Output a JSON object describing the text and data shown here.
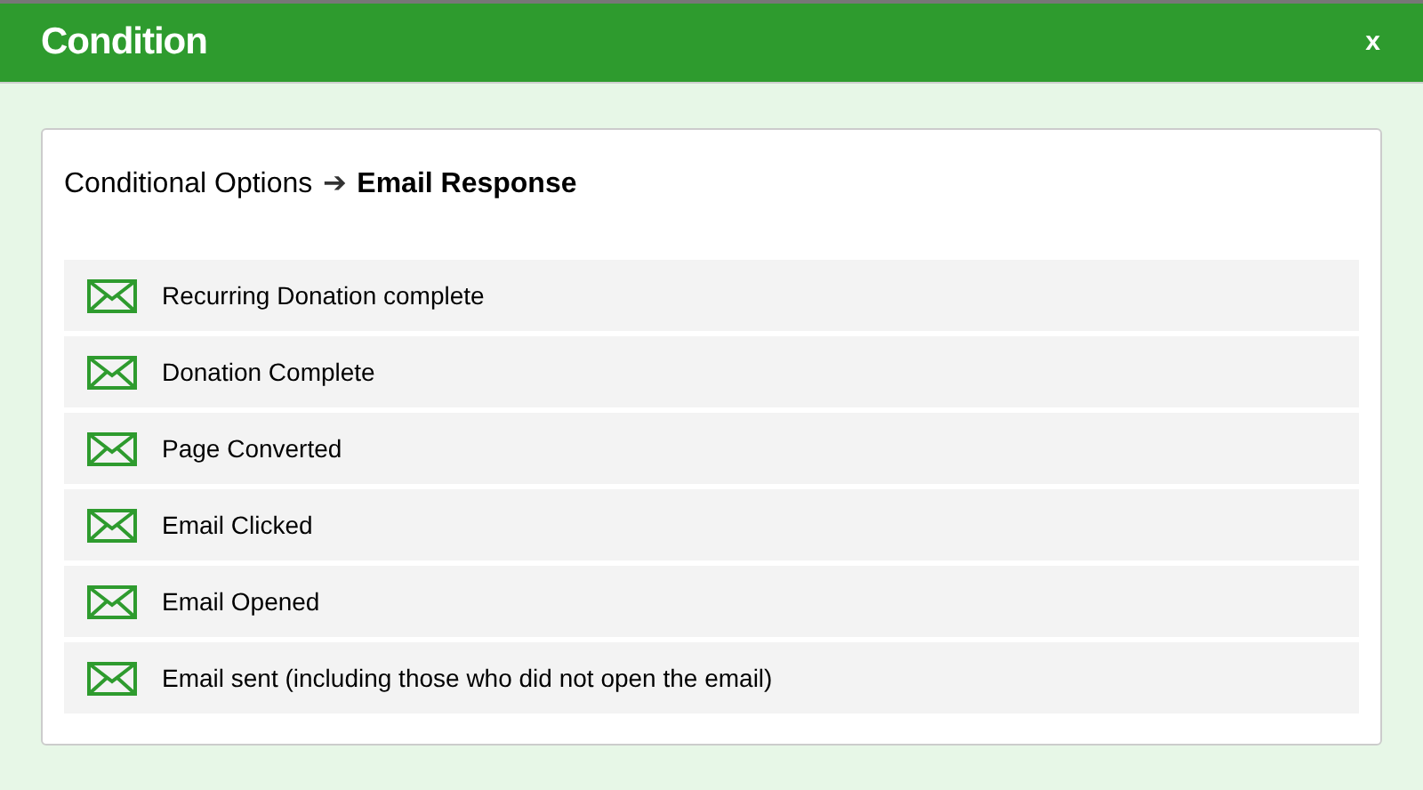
{
  "dialog": {
    "title": "Condition",
    "close": "x"
  },
  "breadcrumb": {
    "parent": "Conditional Options",
    "separator": "➔",
    "current": "Email Response"
  },
  "options": [
    {
      "label": "Recurring Donation complete"
    },
    {
      "label": "Donation Complete"
    },
    {
      "label": "Page Converted"
    },
    {
      "label": "Email Clicked"
    },
    {
      "label": "Email Opened"
    },
    {
      "label": "Email sent (including those who did not open the email)"
    }
  ]
}
